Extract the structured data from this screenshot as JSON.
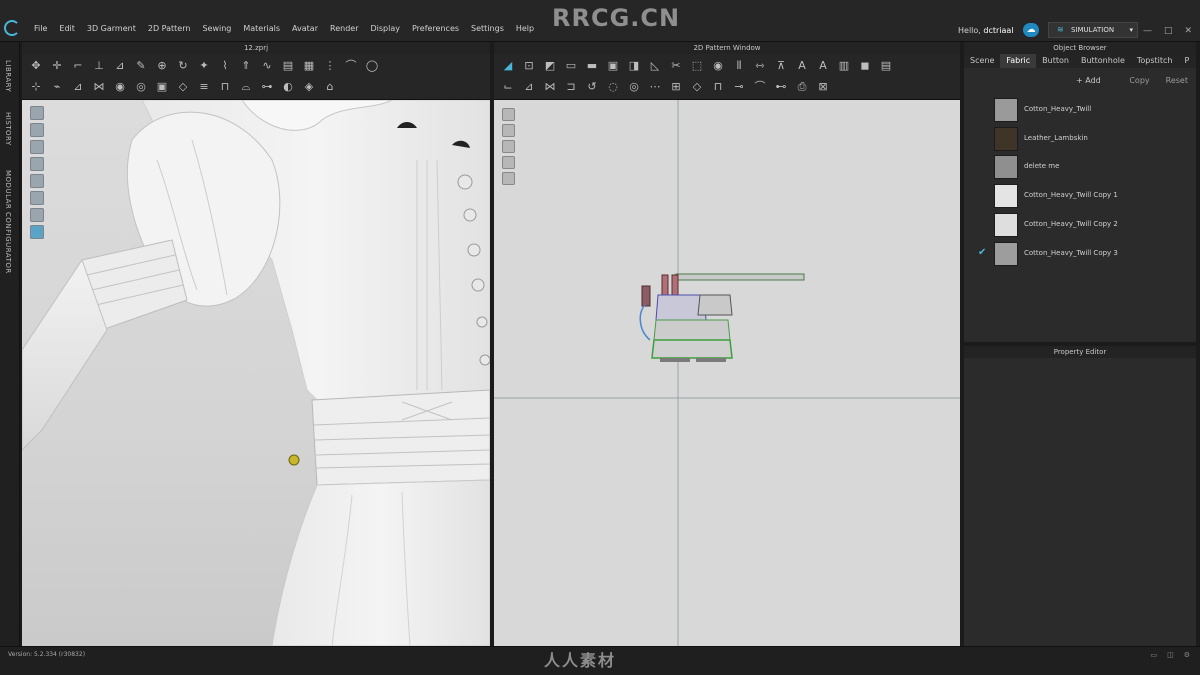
{
  "menubar": {
    "items": [
      "File",
      "Edit",
      "3D Garment",
      "2D Pattern",
      "Sewing",
      "Materials",
      "Avatar",
      "Render",
      "Display",
      "Preferences",
      "Settings",
      "Help"
    ],
    "watermark": "RRCG.CN",
    "greeting": "Hello, ",
    "username": "dctriaal",
    "mode_button": "SIMULATION",
    "window_controls": [
      "—",
      "□",
      "✕"
    ]
  },
  "left_tabs": [
    "LIBRARY",
    "HISTORY",
    "MODULAR CONFIGURATOR"
  ],
  "window3d": {
    "title": "12.zprj"
  },
  "window2d": {
    "title": "2D Pattern Window"
  },
  "object_browser": {
    "title": "Object Browser",
    "tabs": [
      "Scene",
      "Fabric",
      "Button",
      "Buttonhole",
      "Topstitch",
      "P"
    ],
    "active_tab": "Fabric",
    "actions": [
      "+ Add",
      "Copy",
      "Reset"
    ],
    "fabrics": [
      {
        "name": "Cotton_Heavy_Twill",
        "swatch": "#9a9a9a",
        "checked": false
      },
      {
        "name": "Leather_Lambskin",
        "swatch": "#3f3428",
        "checked": false
      },
      {
        "name": "delete me",
        "swatch": "#8f8f8f",
        "checked": false
      },
      {
        "name": "Cotton_Heavy_Twill Copy 1",
        "swatch": "#e4e4e4",
        "checked": false
      },
      {
        "name": "Cotton_Heavy_Twill Copy 2",
        "swatch": "#dedede",
        "checked": false
      },
      {
        "name": "Cotton_Heavy_Twill Copy 3",
        "swatch": "#9d9d9d",
        "checked": true
      }
    ]
  },
  "property_editor": {
    "title": "Property Editor"
  },
  "statusbar": {
    "version": "Version: 5.2.334 (r30832)",
    "watermark": "人人素材"
  },
  "colors": {
    "accent": "#4ab6d8",
    "panel": "#2b2b2b",
    "bg": "#1b1b1b"
  }
}
